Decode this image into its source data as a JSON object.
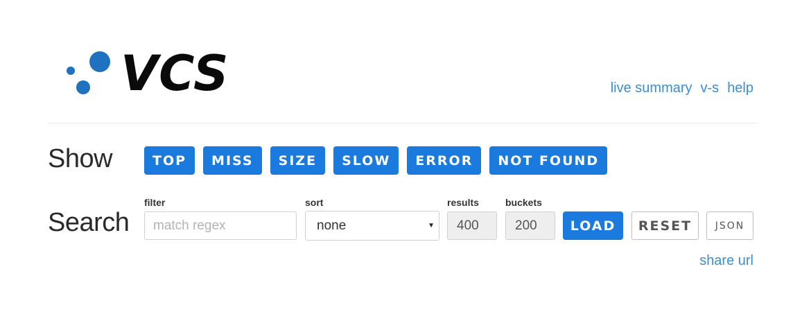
{
  "header": {
    "logo_text": "VCS",
    "nav": [
      {
        "label": "live summary"
      },
      {
        "label": "v-s"
      },
      {
        "label": "help"
      }
    ]
  },
  "show": {
    "title": "Show",
    "buttons": [
      "TOP",
      "MISS",
      "SIZE",
      "SLOW",
      "ERROR",
      "NOT FOUND"
    ]
  },
  "search": {
    "title": "Search",
    "filter": {
      "label": "filter",
      "placeholder": "match regex",
      "value": ""
    },
    "sort": {
      "label": "sort",
      "value": "none"
    },
    "results": {
      "label": "results",
      "value": "400"
    },
    "buckets": {
      "label": "buckets",
      "value": "200"
    },
    "load_label": "LOAD",
    "reset_label": "RESET",
    "json_label": "JSON",
    "share_label": "share url"
  },
  "colors": {
    "accent": "#1a7ade",
    "link": "#3b8ed0",
    "logo_dots": "#1f72bf"
  }
}
